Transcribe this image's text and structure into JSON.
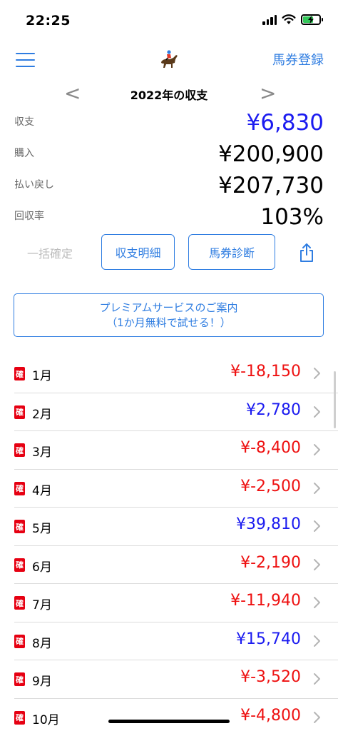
{
  "status_bar": {
    "time": "22:25",
    "battery_level": 0.6,
    "charging": true
  },
  "nav": {
    "menu_icon": "hamburger-icon",
    "logo_icon": "jockey-horse-icon",
    "action_label": "馬券登録"
  },
  "year_header": {
    "prev": "<",
    "title": "2022年の収支",
    "next": ">"
  },
  "summary": {
    "balance_label": "収支",
    "balance_value": "¥6,830",
    "purchase_label": "購入",
    "purchase_value": "¥200,900",
    "payout_label": "払い戻し",
    "payout_value": "¥207,730",
    "return_rate_label": "回収率",
    "return_rate_value": "103%"
  },
  "actions": {
    "confirm_all": "一括確定",
    "details": "収支明細",
    "diagnosis": "馬券診断",
    "share_icon": "share-icon"
  },
  "premium": {
    "line1": "プレミアムサービスのご案内",
    "line2": "（1か月無料で試せる！）"
  },
  "colors": {
    "accent": "#2f7de1",
    "positive": "#1b1bf0",
    "negative": "#ee1111",
    "badge": "#e60012"
  },
  "months": [
    {
      "badge": "確",
      "label": "1月",
      "amount": "¥-18,150",
      "sign": "neg"
    },
    {
      "badge": "確",
      "label": "2月",
      "amount": "¥2,780",
      "sign": "pos"
    },
    {
      "badge": "確",
      "label": "3月",
      "amount": "¥-8,400",
      "sign": "neg"
    },
    {
      "badge": "確",
      "label": "4月",
      "amount": "¥-2,500",
      "sign": "neg"
    },
    {
      "badge": "確",
      "label": "5月",
      "amount": "¥39,810",
      "sign": "pos"
    },
    {
      "badge": "確",
      "label": "6月",
      "amount": "¥-2,190",
      "sign": "neg"
    },
    {
      "badge": "確",
      "label": "7月",
      "amount": "¥-11,940",
      "sign": "neg"
    },
    {
      "badge": "確",
      "label": "8月",
      "amount": "¥15,740",
      "sign": "pos"
    },
    {
      "badge": "確",
      "label": "9月",
      "amount": "¥-3,520",
      "sign": "neg"
    },
    {
      "badge": "確",
      "label": "10月",
      "amount": "¥-4,800",
      "sign": "neg"
    }
  ]
}
